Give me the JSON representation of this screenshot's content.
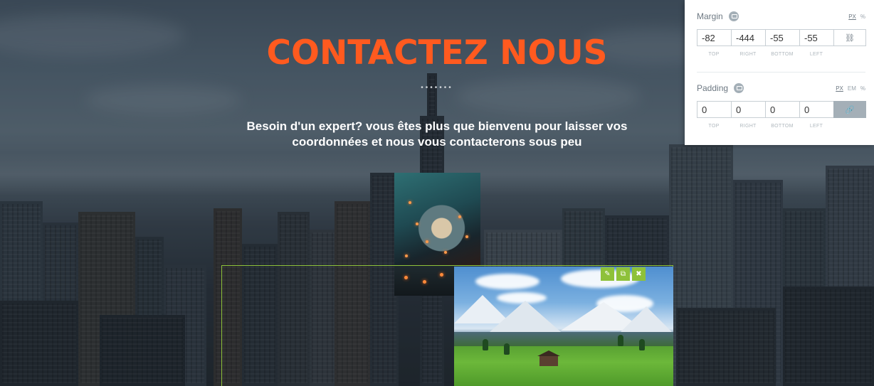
{
  "hero": {
    "title": "CONTACTEZ NOUS",
    "separator": "•••••••",
    "subtitle_line1": "Besoin d'un expert? vous êtes plus que bienvenu pour laisser vos",
    "subtitle_line2": "coordonnées et nous vous contacterons sous peu"
  },
  "images": [
    {
      "name": "crystal-ball-photo",
      "icon": "photo"
    },
    {
      "name": "mountain-meadow-photo",
      "icon": "photo"
    }
  ],
  "element_toolbar": {
    "edit_icon": "✎",
    "duplicate_icon": "⧉",
    "delete_icon": "✖",
    "accent_color": "#8ec13a"
  },
  "spacing_panel": {
    "margin": {
      "label": "Margin",
      "units": [
        "PX",
        "%"
      ],
      "active_unit": "PX",
      "values": {
        "top": "-82",
        "right": "-444",
        "bottom": "-55",
        "left": "-55"
      },
      "linked": false
    },
    "padding": {
      "label": "Padding",
      "units": [
        "PX",
        "EM",
        "%"
      ],
      "active_unit": "PX",
      "values": {
        "top": "0",
        "right": "0",
        "bottom": "0",
        "left": "0"
      },
      "linked": true
    },
    "side_labels": [
      "TOP",
      "RIGHT",
      "BOTTOM",
      "LEFT"
    ],
    "link_icon_unlinked": "⛓",
    "link_icon_linked": "🔗"
  },
  "colors": {
    "title": "#ff5a1f",
    "selection": "#8ec13a"
  }
}
